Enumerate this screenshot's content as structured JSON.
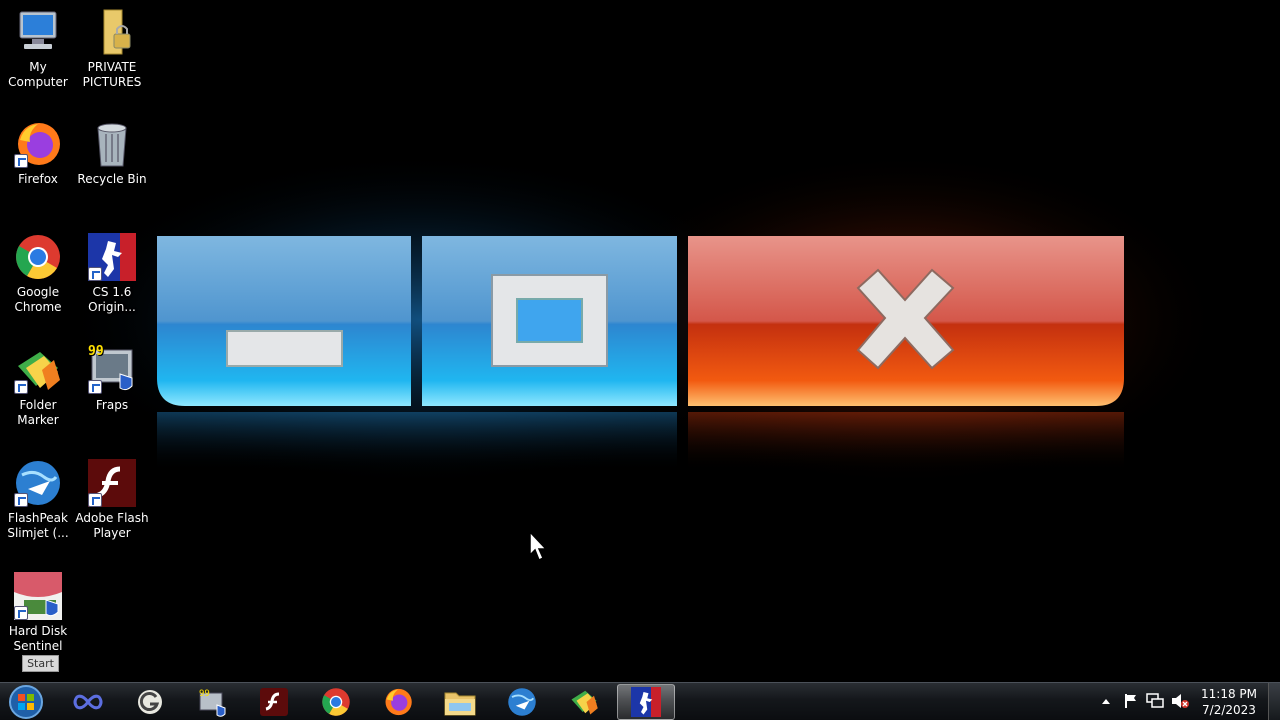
{
  "desktop": {
    "icons": [
      {
        "label": "My Computer",
        "icon": "computer-icon"
      },
      {
        "label": "PRIVATE PICTURES",
        "icon": "locked-folder-icon"
      },
      {
        "label": "Firefox",
        "icon": "firefox-icon"
      },
      {
        "label": "Recycle Bin",
        "icon": "recycle-bin-icon"
      },
      {
        "label": "Google Chrome",
        "icon": "chrome-icon"
      },
      {
        "label": "CS 1.6 Origin...",
        "icon": "counter-strike-icon"
      },
      {
        "label": "Folder Marker",
        "icon": "folder-marker-icon"
      },
      {
        "label": "Fraps",
        "icon": "fraps-icon"
      },
      {
        "label": "FlashPeak Slimjet (...",
        "icon": "slimjet-icon"
      },
      {
        "label": "Adobe Flash Player",
        "icon": "flash-player-icon"
      },
      {
        "label": "Hard Disk Sentinel",
        "icon": "hard-disk-sentinel-icon"
      }
    ],
    "tooltip": "Start",
    "fraps_badge": "99"
  },
  "taskbar": {
    "items": [
      {
        "icon": "infinity-app-icon"
      },
      {
        "icon": "g-app-icon"
      },
      {
        "icon": "fraps-icon"
      },
      {
        "icon": "flash-player-icon"
      },
      {
        "icon": "chrome-icon"
      },
      {
        "icon": "firefox-icon"
      },
      {
        "icon": "file-explorer-icon"
      },
      {
        "icon": "slimjet-icon"
      },
      {
        "icon": "folder-marker-icon"
      },
      {
        "icon": "counter-strike-icon",
        "active": true
      }
    ],
    "clock": {
      "time": "11:18 PM",
      "date": "7/2/2023"
    }
  },
  "colors": {
    "blue_glow": "#2aa3ff",
    "red_glow": "#ff4a10",
    "taskbar": "#14171b"
  }
}
